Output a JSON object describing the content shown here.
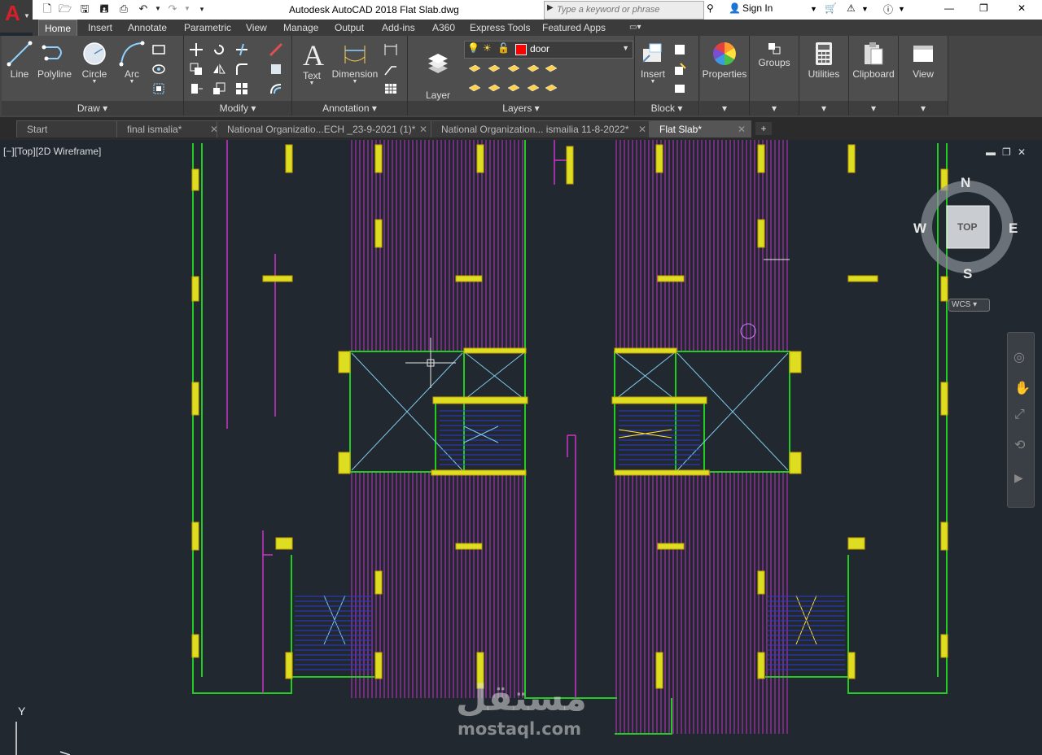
{
  "app": {
    "title": "Autodesk AutoCAD 2018    Flat Slab.dwg",
    "logo": "A",
    "search_placeholder": "Type a keyword or phrase",
    "sign_in": "Sign In",
    "window_controls": [
      "—",
      "❐",
      "✕"
    ]
  },
  "ribbon_tabs": [
    "Home",
    "Insert",
    "Annotate",
    "Parametric",
    "View",
    "Manage",
    "Output",
    "Add-ins",
    "A360",
    "Express Tools",
    "Featured Apps"
  ],
  "ribbon": {
    "draw": {
      "title": "Draw",
      "line": "Line",
      "polyline": "Polyline",
      "circle": "Circle",
      "arc": "Arc"
    },
    "modify": {
      "title": "Modify"
    },
    "annotation": {
      "title": "Annotation",
      "text": "Text",
      "dimension": "Dimension"
    },
    "layers": {
      "title": "Layers",
      "layer_properties": "Layer\nProperties",
      "current_layer": "door"
    },
    "block": {
      "title": "Block",
      "insert": "Insert"
    },
    "properties": "Properties",
    "groups": "Groups",
    "utilities": "Utilities",
    "clipboard": "Clipboard",
    "view": "View"
  },
  "doc_tabs": [
    "Start",
    "final ismalia*",
    "National Organizatio...ECH _23-9-2021 (1)*",
    "National Organization... ismailia 11-8-2022*",
    "Flat Slab*"
  ],
  "viewport": {
    "label": "[−][Top][2D Wireframe]",
    "viewcube": {
      "n": "N",
      "s": "S",
      "e": "E",
      "w": "W",
      "face": "TOP",
      "ucs": "WCS"
    },
    "ucs_y": "Y"
  },
  "watermark": {
    "ar": "مستقل",
    "en": "mostaql.com"
  },
  "colors": {
    "accent": "#d8202a",
    "slab": "#cc33cc",
    "wall": "#22cc22",
    "column": "#dddd22",
    "canvas": "#212830"
  }
}
